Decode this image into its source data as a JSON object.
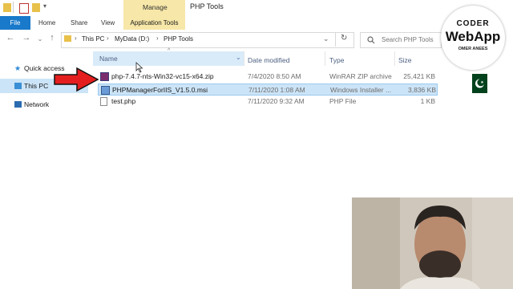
{
  "window": {
    "title": "PHP Tools"
  },
  "ribbon": {
    "manage_label": "Manage",
    "tabs": [
      "Home",
      "Share",
      "View"
    ],
    "file_label": "File",
    "app_tools_label": "Application Tools"
  },
  "address": {
    "crumbs": [
      "This PC",
      "MyData (D:)",
      "PHP Tools"
    ],
    "search_placeholder": "Search PHP Tools"
  },
  "nav_pane": {
    "items": [
      "Quick access",
      "This PC",
      "Network"
    ]
  },
  "columns": {
    "name": "Name",
    "date": "Date modified",
    "type": "Type",
    "size": "Size"
  },
  "files": [
    {
      "name": "php-7.4.7-nts-Win32-vc15-x64.zip",
      "date": "7/4/2020 8:50 AM",
      "type": "WinRAR ZIP archive",
      "size": "25,421 KB",
      "icon": "winrar-archive-icon"
    },
    {
      "name": "PHPManagerForIIS_V1.5.0.msi",
      "date": "7/11/2020 1:08 AM",
      "type": "Windows Installer ...",
      "size": "3,836 KB",
      "icon": "msi-installer-icon",
      "selected": true
    },
    {
      "name": "test.php",
      "date": "7/11/2020 9:32 AM",
      "type": "PHP File",
      "size": "1 KB",
      "icon": "php-file-icon"
    }
  ],
  "overlay": {
    "logo_top": "CODER",
    "logo_main": "WebApp",
    "logo_bottom": "OMER ANEES"
  },
  "colors": {
    "selection": "#cce4f7",
    "file_tab": "#1979ca",
    "manage_tab": "#f7e7a8",
    "arrow": "#e41e1e"
  }
}
